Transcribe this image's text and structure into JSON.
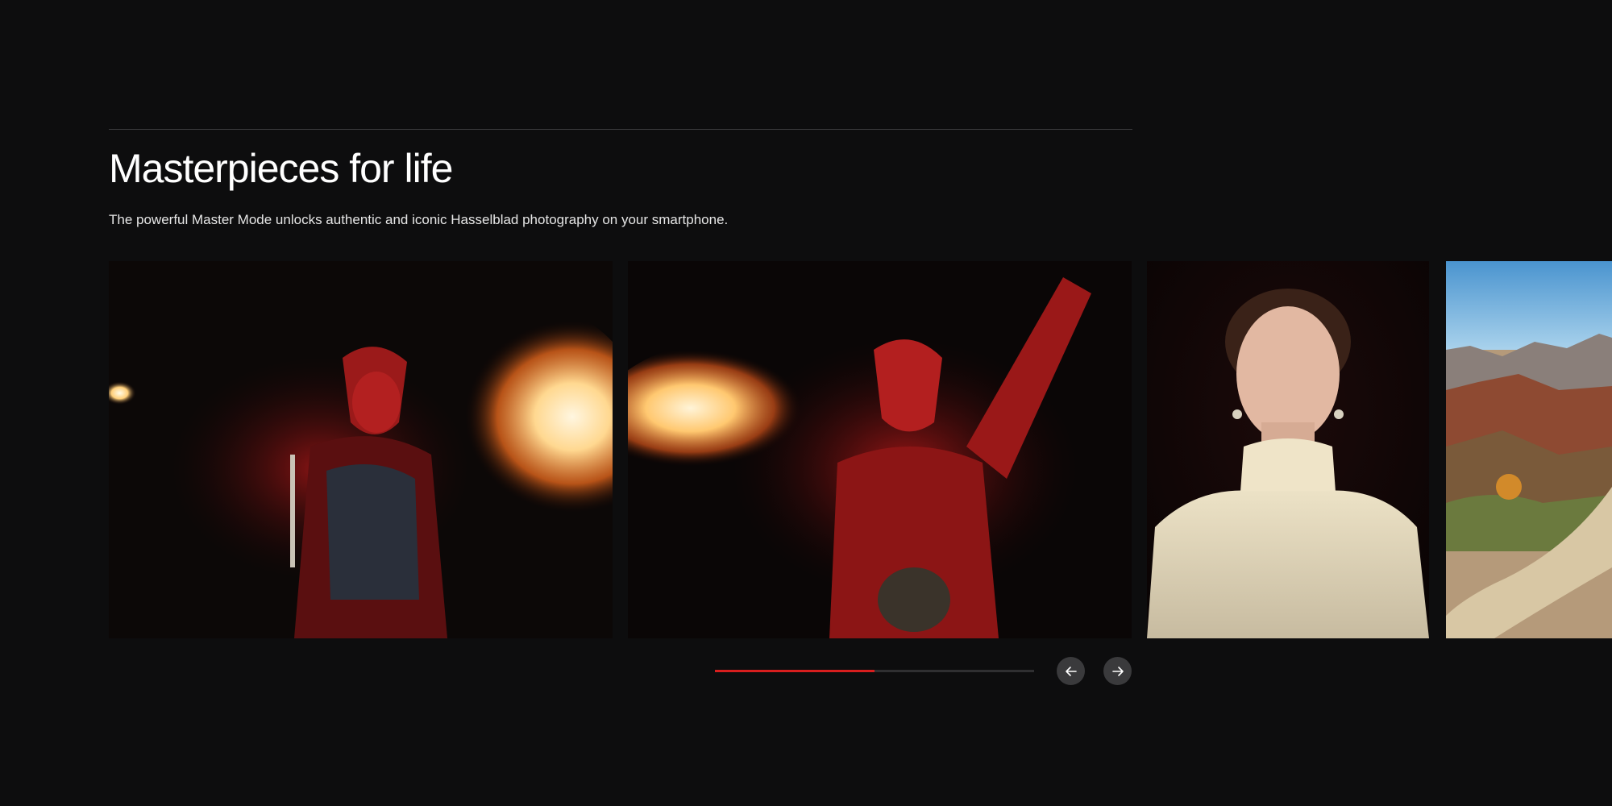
{
  "section": {
    "title": "Masterpieces for life",
    "subtitle": "The powerful Master Mode unlocks authentic and iconic Hasselblad photography on your smartphone."
  },
  "carousel": {
    "slides": [
      {
        "subject": "fire-breathing performer in red mask"
      },
      {
        "subject": "fire-breathing performer raising arm"
      },
      {
        "subject": "portrait of woman in lace turtleneck"
      },
      {
        "subject": "desert landscape with mountains and dirt road"
      }
    ],
    "progress_fraction": 0.5
  },
  "controls": {
    "prev_icon": "arrow-left-icon",
    "next_icon": "arrow-right-icon"
  },
  "colors": {
    "background": "#0d0d0e",
    "accent": "#d81e1e",
    "button": "#3a3a3c"
  }
}
